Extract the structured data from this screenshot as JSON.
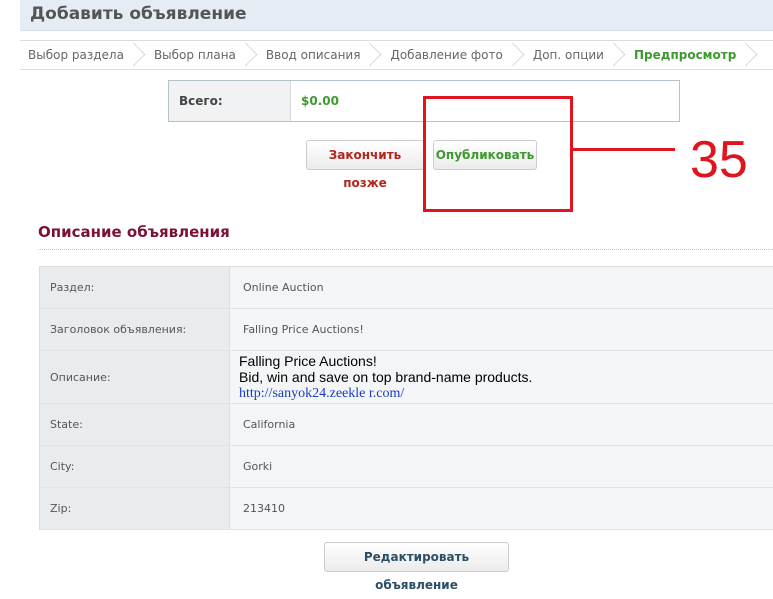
{
  "header": {
    "title": "Добавить объявление"
  },
  "steps": [
    {
      "label": "Выбор раздела"
    },
    {
      "label": "Выбор плана"
    },
    {
      "label": "Ввод описания"
    },
    {
      "label": "Добавление фото"
    },
    {
      "label": "Доп. опции"
    },
    {
      "label": "Предпросмотр",
      "active": true
    }
  ],
  "total": {
    "label": "Всего:",
    "value": "$0.00"
  },
  "actions": {
    "later_label": "Закончить позже",
    "publish_label": "Опубликовать"
  },
  "annotation": {
    "number": "35",
    "color": "#e0141e"
  },
  "section": {
    "title": "Описание объявления"
  },
  "details": {
    "section_label": "Раздел:",
    "section_value": "Online Auction",
    "title_label": "Заголовок объявления:",
    "title_value": "Falling Price Auctions!",
    "description_label": "Описание:",
    "description_line1": "Falling Price Auctions!",
    "description_line2": "Bid, win and save on top brand-name products.",
    "description_link": "http://sanyok24.zeekle r.com/",
    "state_label": "State:",
    "state_value": "California",
    "city_label": "City:",
    "city_value": "Gorki",
    "zip_label": "Zip:",
    "zip_value": "213410"
  },
  "edit": {
    "label": "Редактировать объявление"
  },
  "colors": {
    "accent_green": "#3d9a2f",
    "danger_red": "#b3261e",
    "section_title": "#7a1232"
  }
}
